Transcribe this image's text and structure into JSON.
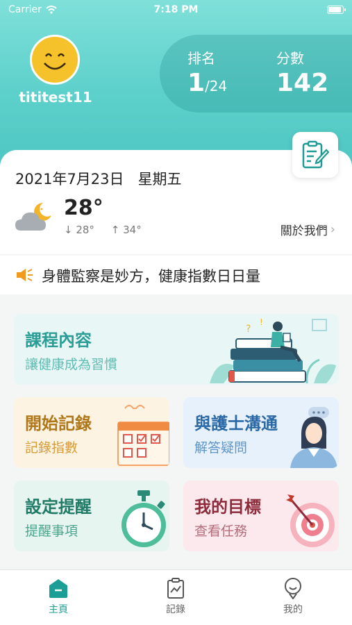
{
  "status_bar": {
    "carrier": "Carrier",
    "time": "7:18 PM"
  },
  "profile": {
    "username": "tititest11"
  },
  "stats": {
    "rank_label": "排名",
    "rank_value": "1",
    "rank_total": "/24",
    "score_label": "分數",
    "score_value": "142"
  },
  "info": {
    "date": "2021年7月23日",
    "weekday": "星期五",
    "temperature": "28°",
    "low": "↓ 28°",
    "high": "↑ 34°",
    "weather_icon": "partly-cloudy-night-icon",
    "about_label": "關於我們"
  },
  "banner": {
    "text": "身體監察是妙方，健康指數日日量"
  },
  "tiles": {
    "course": {
      "title": "課程內容",
      "subtitle": "讓健康成為習慣"
    },
    "record": {
      "title": "開始記錄",
      "subtitle": "記錄指數"
    },
    "nurse": {
      "title": "與護士溝通",
      "subtitle": "解答疑問"
    },
    "reminder": {
      "title": "設定提醒",
      "subtitle": "提醒事項"
    },
    "goal": {
      "title": "我的目標",
      "subtitle": "查看任務"
    }
  },
  "tabs": [
    {
      "label": "主頁",
      "icon": "home-icon",
      "active": true
    },
    {
      "label": "記錄",
      "icon": "records-icon",
      "active": false
    },
    {
      "label": "我的",
      "icon": "profile-icon",
      "active": false
    }
  ],
  "colors": {
    "accent": "#1b9e95",
    "header": "#5dd0cb"
  }
}
